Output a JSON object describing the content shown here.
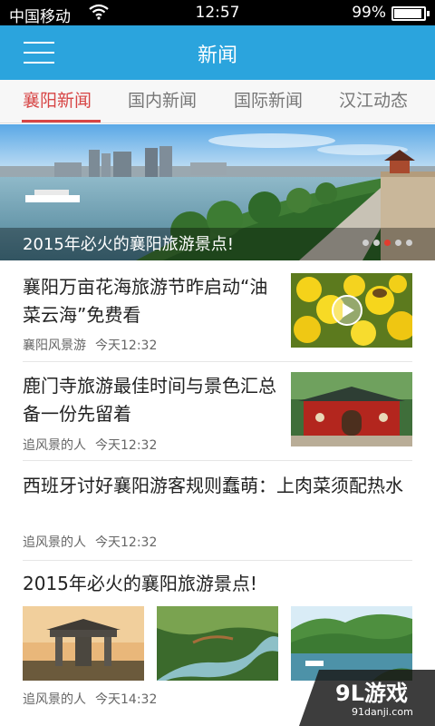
{
  "status_bar": {
    "carrier": "中国移动",
    "time": "12:57",
    "battery": "99%"
  },
  "header": {
    "title": "新闻"
  },
  "tabs": [
    {
      "label": "襄阳新闻"
    },
    {
      "label": "国内新闻"
    },
    {
      "label": "国际新闻"
    },
    {
      "label": "汉江动态"
    }
  ],
  "banner": {
    "caption": "2015年必火的襄阳旅游景点!"
  },
  "news": [
    {
      "title": "襄阳万亩花海旅游节昨启动“油菜云海”免费看",
      "source": "襄阳风景游",
      "time": "今天12:32"
    },
    {
      "title": "鹿门寺旅游最佳时间与景色汇总备一份先留着",
      "source": "追风景的人",
      "time": "今天12:32"
    },
    {
      "title": "西班牙讨好襄阳游客规则蠢萌：上肉菜须配热水",
      "source": "追风景的人",
      "time": "今天12:32"
    },
    {
      "title": "2015年必火的襄阳旅游景点!",
      "source": "追风景的人",
      "time": "今天14:32"
    }
  ],
  "watermark": {
    "brand": "9L游戏",
    "url": "91danji.com"
  },
  "colors": {
    "header_bg": "#2ba4dd",
    "tab_active": "#d74545"
  }
}
